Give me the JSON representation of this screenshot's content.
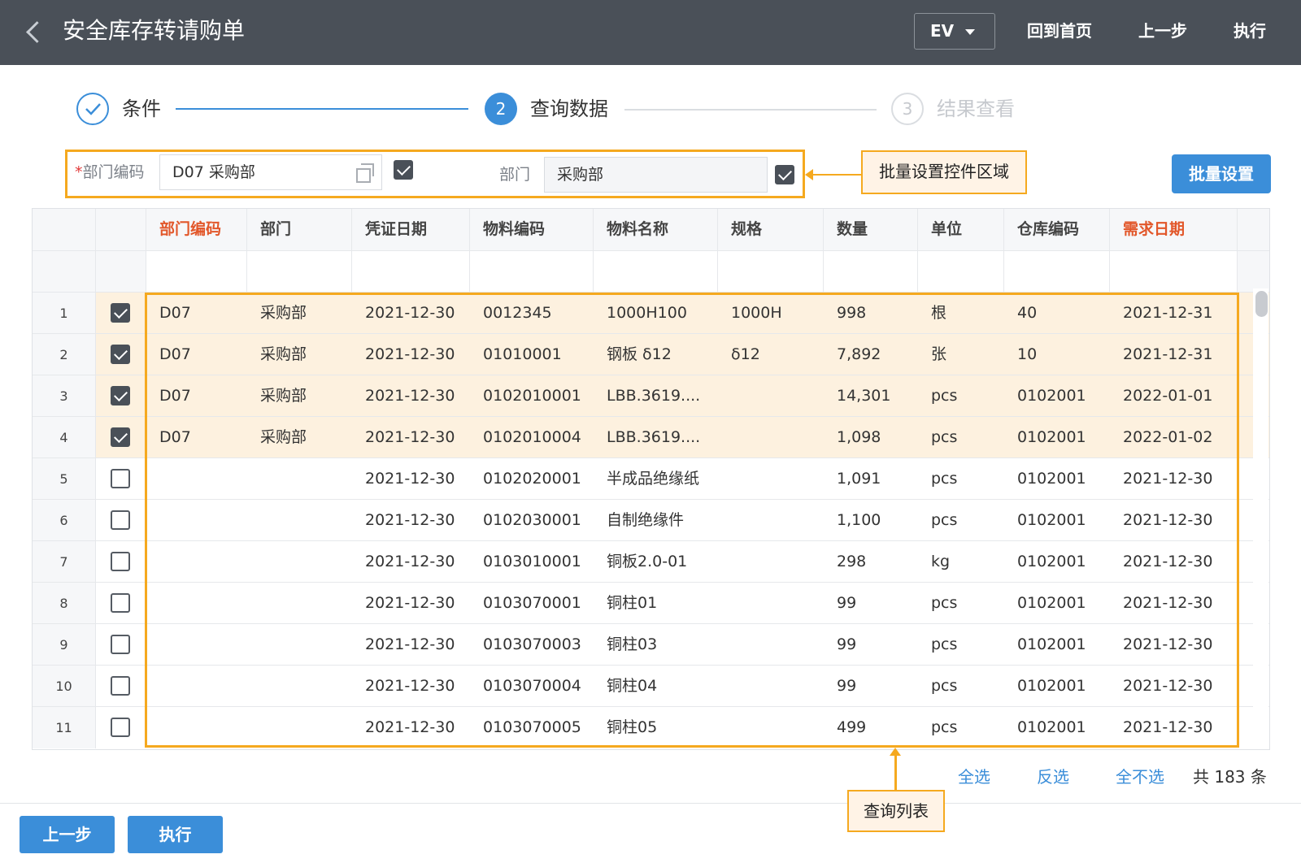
{
  "header": {
    "title": "安全库存转请购单",
    "env_selector": "EV",
    "home_label": "回到首页",
    "prev_label": "上一步",
    "execute_label": "执行"
  },
  "steps": [
    {
      "label": "条件",
      "state": "done"
    },
    {
      "number": "2",
      "label": "查询数据",
      "state": "active"
    },
    {
      "number": "3",
      "label": "结果查看",
      "state": "pending"
    }
  ],
  "batch": {
    "dept_code_label": "*部门编码",
    "dept_code_required_mark": "*",
    "dept_code_text": "部门编码",
    "dept_code_value": "D07 采购部",
    "dept_code_checked": true,
    "dept_label": "部门",
    "dept_value": "采购部",
    "dept_checked": true,
    "batch_button": "批量设置"
  },
  "callouts": {
    "batch_area": "批量设置控件区域",
    "query_list": "查询列表"
  },
  "table": {
    "columns": [
      "部门编码",
      "部门",
      "凭证日期",
      "物料编码",
      "物料名称",
      "规格",
      "数量",
      "单位",
      "仓库编码",
      "需求日期"
    ],
    "rows": [
      {
        "n": "1",
        "checked": true,
        "dept_code": "D07",
        "dept": "采购部",
        "date": "2021-12-30",
        "item_code": "0012345",
        "item_name": "1000H100",
        "spec": "1000H",
        "qty": "998",
        "unit": "根",
        "wh": "40",
        "need_date": "2021-12-31"
      },
      {
        "n": "2",
        "checked": true,
        "dept_code": "D07",
        "dept": "采购部",
        "date": "2021-12-30",
        "item_code": "01010001",
        "item_name": "钢板 δ12",
        "spec": "δ12",
        "qty": "7,892",
        "unit": "张",
        "wh": "10",
        "need_date": "2021-12-31"
      },
      {
        "n": "3",
        "checked": true,
        "dept_code": "D07",
        "dept": "采购部",
        "date": "2021-12-30",
        "item_code": "0102010001",
        "item_name": "LBB.3619....",
        "spec": "",
        "qty": "14,301",
        "unit": "pcs",
        "wh": "0102001",
        "need_date": "2022-01-01"
      },
      {
        "n": "4",
        "checked": true,
        "dept_code": "D07",
        "dept": "采购部",
        "date": "2021-12-30",
        "item_code": "0102010004",
        "item_name": "LBB.3619....",
        "spec": "",
        "qty": "1,098",
        "unit": "pcs",
        "wh": "0102001",
        "need_date": "2022-01-02"
      },
      {
        "n": "5",
        "checked": false,
        "dept_code": "",
        "dept": "",
        "date": "2021-12-30",
        "item_code": "0102020001",
        "item_name": "半成品绝缘纸",
        "spec": "",
        "qty": "1,091",
        "unit": "pcs",
        "wh": "0102001",
        "need_date": "2021-12-30"
      },
      {
        "n": "6",
        "checked": false,
        "dept_code": "",
        "dept": "",
        "date": "2021-12-30",
        "item_code": "0102030001",
        "item_name": "自制绝缘件",
        "spec": "",
        "qty": "1,100",
        "unit": "pcs",
        "wh": "0102001",
        "need_date": "2021-12-30"
      },
      {
        "n": "7",
        "checked": false,
        "dept_code": "",
        "dept": "",
        "date": "2021-12-30",
        "item_code": "0103010001",
        "item_name": "铜板2.0-01",
        "spec": "",
        "qty": "298",
        "unit": "kg",
        "wh": "0102001",
        "need_date": "2021-12-30"
      },
      {
        "n": "8",
        "checked": false,
        "dept_code": "",
        "dept": "",
        "date": "2021-12-30",
        "item_code": "0103070001",
        "item_name": "铜柱01",
        "spec": "",
        "qty": "99",
        "unit": "pcs",
        "wh": "0102001",
        "need_date": "2021-12-30"
      },
      {
        "n": "9",
        "checked": false,
        "dept_code": "",
        "dept": "",
        "date": "2021-12-30",
        "item_code": "0103070003",
        "item_name": "铜柱03",
        "spec": "",
        "qty": "99",
        "unit": "pcs",
        "wh": "0102001",
        "need_date": "2021-12-30"
      },
      {
        "n": "10",
        "checked": false,
        "dept_code": "",
        "dept": "",
        "date": "2021-12-30",
        "item_code": "0103070004",
        "item_name": "铜柱04",
        "spec": "",
        "qty": "99",
        "unit": "pcs",
        "wh": "0102001",
        "need_date": "2021-12-30"
      },
      {
        "n": "11",
        "checked": false,
        "dept_code": "",
        "dept": "",
        "date": "2021-12-30",
        "item_code": "0103070005",
        "item_name": "铜柱05",
        "spec": "",
        "qty": "499",
        "unit": "pcs",
        "wh": "0102001",
        "need_date": "2021-12-30"
      }
    ]
  },
  "list_actions": {
    "select_all": "全选",
    "invert": "反选",
    "select_none": "全不选",
    "total": "共 183 条"
  },
  "footer": {
    "prev_label": "上一步",
    "execute_label": "执行"
  },
  "colors": {
    "header_bg": "#4a5058",
    "accent_blue": "#3b8ed9",
    "highlight_orange": "#f5a91f",
    "selected_row": "#fdf1df",
    "required_col": "#e2572a"
  }
}
